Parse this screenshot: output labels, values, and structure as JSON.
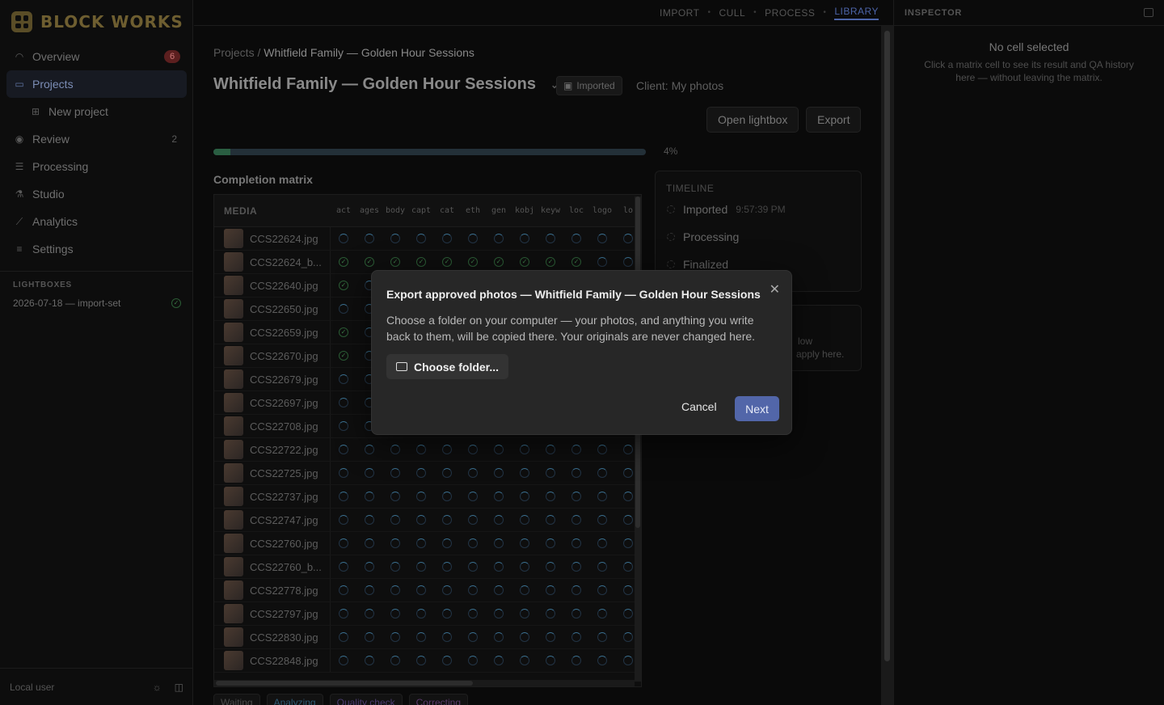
{
  "brand": {
    "name": "BLOCK WORKS"
  },
  "nav": {
    "overview": {
      "label": "Overview",
      "badge": "6"
    },
    "projects": {
      "label": "Projects"
    },
    "new_project": {
      "label": "New project"
    },
    "review": {
      "label": "Review",
      "count": "2"
    },
    "processing": {
      "label": "Processing"
    },
    "studio": {
      "label": "Studio"
    },
    "analytics": {
      "label": "Analytics"
    },
    "settings": {
      "label": "Settings"
    }
  },
  "lightboxes": {
    "title": "LIGHTBOXES",
    "item": "2026-07-18 — import-set"
  },
  "footer": {
    "user": "Local user"
  },
  "topnav": {
    "import": "IMPORT",
    "cull": "CULL",
    "process": "PROCESS",
    "library": "LIBRARY"
  },
  "inspector": {
    "title": "INSPECTOR",
    "empty": "No cell selected",
    "hint": "Click a matrix cell to see its result and QA history here — without leaving the matrix."
  },
  "project": {
    "crumb_root": "Projects",
    "crumb_sep": "/",
    "crumb_current": "Whitfield Family — Golden Hour Sessions",
    "title": "Whitfield Family — Golden Hour Sessions",
    "status": "Imported",
    "client": "Client: My photos",
    "open_lightbox": "Open lightbox",
    "export": "Export",
    "progress_pct": "4%",
    "progress": 0.04
  },
  "matrix": {
    "title": "Completion matrix",
    "media_header": "MEDIA",
    "columns": [
      "act",
      "ages",
      "body",
      "capt",
      "cat",
      "eth",
      "gen",
      "kobj",
      "keyw",
      "loc",
      "logo",
      "lo"
    ],
    "rows": [
      {
        "file": "CCS22624.jpg",
        "state": "spin"
      },
      {
        "file": "CCS22624_b...",
        "state": "ok"
      },
      {
        "file": "CCS22640.jpg",
        "state": "ok"
      },
      {
        "file": "CCS22650.jpg",
        "state": "spin"
      },
      {
        "file": "CCS22659.jpg",
        "state": "ok"
      },
      {
        "file": "CCS22670.jpg",
        "state": "ok"
      },
      {
        "file": "CCS22679.jpg",
        "state": "spin"
      },
      {
        "file": "CCS22697.jpg",
        "state": "spin"
      },
      {
        "file": "CCS22708.jpg",
        "state": "spin"
      },
      {
        "file": "CCS22722.jpg",
        "state": "spin"
      },
      {
        "file": "CCS22725.jpg",
        "state": "spin"
      },
      {
        "file": "CCS22737.jpg",
        "state": "spin"
      },
      {
        "file": "CCS22747.jpg",
        "state": "spin"
      },
      {
        "file": "CCS22760.jpg",
        "state": "spin"
      },
      {
        "file": "CCS22760_b...",
        "state": "spin"
      },
      {
        "file": "CCS22778.jpg",
        "state": "spin"
      },
      {
        "file": "CCS22797.jpg",
        "state": "spin"
      },
      {
        "file": "CCS22830.jpg",
        "state": "spin"
      },
      {
        "file": "CCS22848.jpg",
        "state": "spin"
      }
    ]
  },
  "timeline": {
    "title": "TIMELINE",
    "imported": "Imported",
    "imported_time": "9:57:39 PM",
    "processing": "Processing",
    "finalized": "Finalized"
  },
  "card2": {
    "line1": "low",
    "line2": "apply here."
  },
  "legend": {
    "waiting": "Waiting",
    "analyzing": "Analyzing",
    "qa": "Quality check",
    "correcting": "Correcting"
  },
  "dialog": {
    "title": "Export approved photos — Whitfield Family — Golden Hour Sessions",
    "body": "Choose a folder on your computer — your photos, and anything you write back to them, will be copied there. Your originals are never changed here.",
    "choose": "Choose folder...",
    "cancel": "Cancel",
    "next": "Next"
  }
}
